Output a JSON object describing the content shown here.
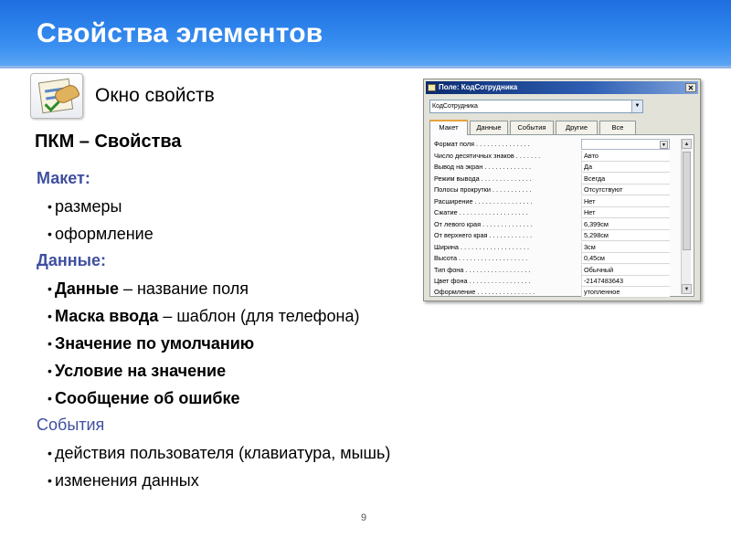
{
  "slide": {
    "title": "Свойства элементов",
    "window_label": "Окно свойств",
    "pkm": "ПКМ – Свойства",
    "page_number": "9",
    "accent_color": "#2a7fe9",
    "section_color": "#3f4fa0",
    "icon": "properties-icon"
  },
  "sections": [
    {
      "heading": "Макет:",
      "items": [
        "размеры",
        "оформление"
      ]
    },
    {
      "heading": "Данные:",
      "items": [
        {
          "bold": "Данные",
          "rest": " – название поля"
        },
        {
          "bold": "Маска ввода",
          "rest": " – шаблон (для телефона)"
        },
        {
          "bold": "Значение по умолчанию",
          "rest": ""
        },
        {
          "bold": "Условие на значение",
          "rest": ""
        },
        {
          "bold": "Сообщение об ошибке",
          "rest": ""
        }
      ]
    },
    {
      "heading": "События",
      "items": [
        "действия пользователя (клавиатура, мышь)",
        "изменения данных"
      ]
    }
  ],
  "properties_window": {
    "title": "Поле: КодСотрудника",
    "close_label": "✕",
    "object_name": "КодСотрудника",
    "tabs": [
      "Макет",
      "Данные",
      "События",
      "Другие",
      "Все"
    ],
    "active_tab": "Макет",
    "properties": [
      {
        "name": "Формат поля . . . . . . . . . . . . . . .",
        "value": ""
      },
      {
        "name": "Число десятичных знаков . . . . . . .",
        "value": "Авто"
      },
      {
        "name": "Вывод на экран . . . . . . . . . . . . .",
        "value": "Да"
      },
      {
        "name": "Режим вывода . . . . . . . . . . . . . .",
        "value": "Всегда"
      },
      {
        "name": "Полосы прокрутки . . . . . . . . . . .",
        "value": "Отсутствуют"
      },
      {
        "name": "Расширение . . . . . . . . . . . . . . . .",
        "value": "Нет"
      },
      {
        "name": "Сжатие . . . . . . . . . . . . . . . . . . .",
        "value": "Нет"
      },
      {
        "name": "От левого края . . . . . . . . . . . . . .",
        "value": "6,399см"
      },
      {
        "name": "От верхнего края . . . . . . . . . . . .",
        "value": "5,298см"
      },
      {
        "name": "Ширина . . . . . . . . . . . . . . . . . . .",
        "value": "3см"
      },
      {
        "name": "Высота . . . . . . . . . . . . . . . . . . .",
        "value": "0,45см"
      },
      {
        "name": "Тип фона . . . . . . . . . . . . . . . . . .",
        "value": "Обычный"
      },
      {
        "name": "Цвет фона . . . . . . . . . . . . . . . . .",
        "value": "-2147483643"
      },
      {
        "name": "Оформление . . . . . . . . . . . . . . . .",
        "value": "утопленное"
      }
    ]
  }
}
